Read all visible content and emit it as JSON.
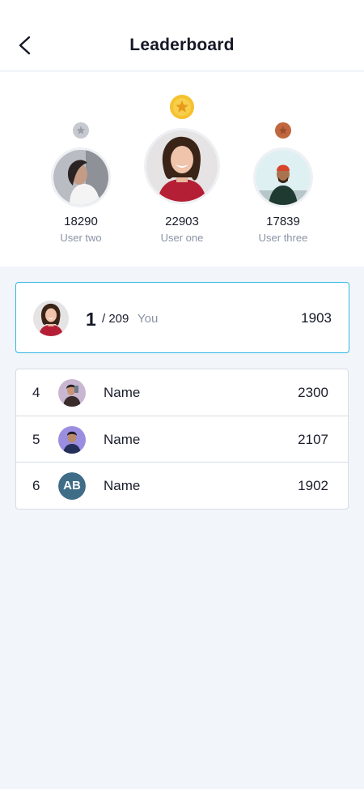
{
  "header": {
    "title": "Leaderboard",
    "back_icon": "chevron-left-icon"
  },
  "podium": [
    {
      "place": 1,
      "score": "22903",
      "name": "User one",
      "medal": "gold",
      "medal_color": "#f5c12e"
    },
    {
      "place": 2,
      "score": "18290",
      "name": "User two",
      "medal": "silver",
      "medal_color": "#c6c9cf"
    },
    {
      "place": 3,
      "score": "17839",
      "name": "User three",
      "medal": "bronze",
      "medal_color": "#c0673f"
    }
  ],
  "current_user": {
    "rank": "1",
    "total": "/ 209",
    "label": "You",
    "score": "1903"
  },
  "list": [
    {
      "rank": "4",
      "name": "Name",
      "score": "2300"
    },
    {
      "rank": "5",
      "name": "Name",
      "score": "2107"
    },
    {
      "rank": "6",
      "name": "Name",
      "score": "1902",
      "initials": "AB"
    }
  ],
  "colors": {
    "accent": "#34b7e4",
    "background": "#f2f5fa",
    "initials_bg": "#3f6d87"
  }
}
